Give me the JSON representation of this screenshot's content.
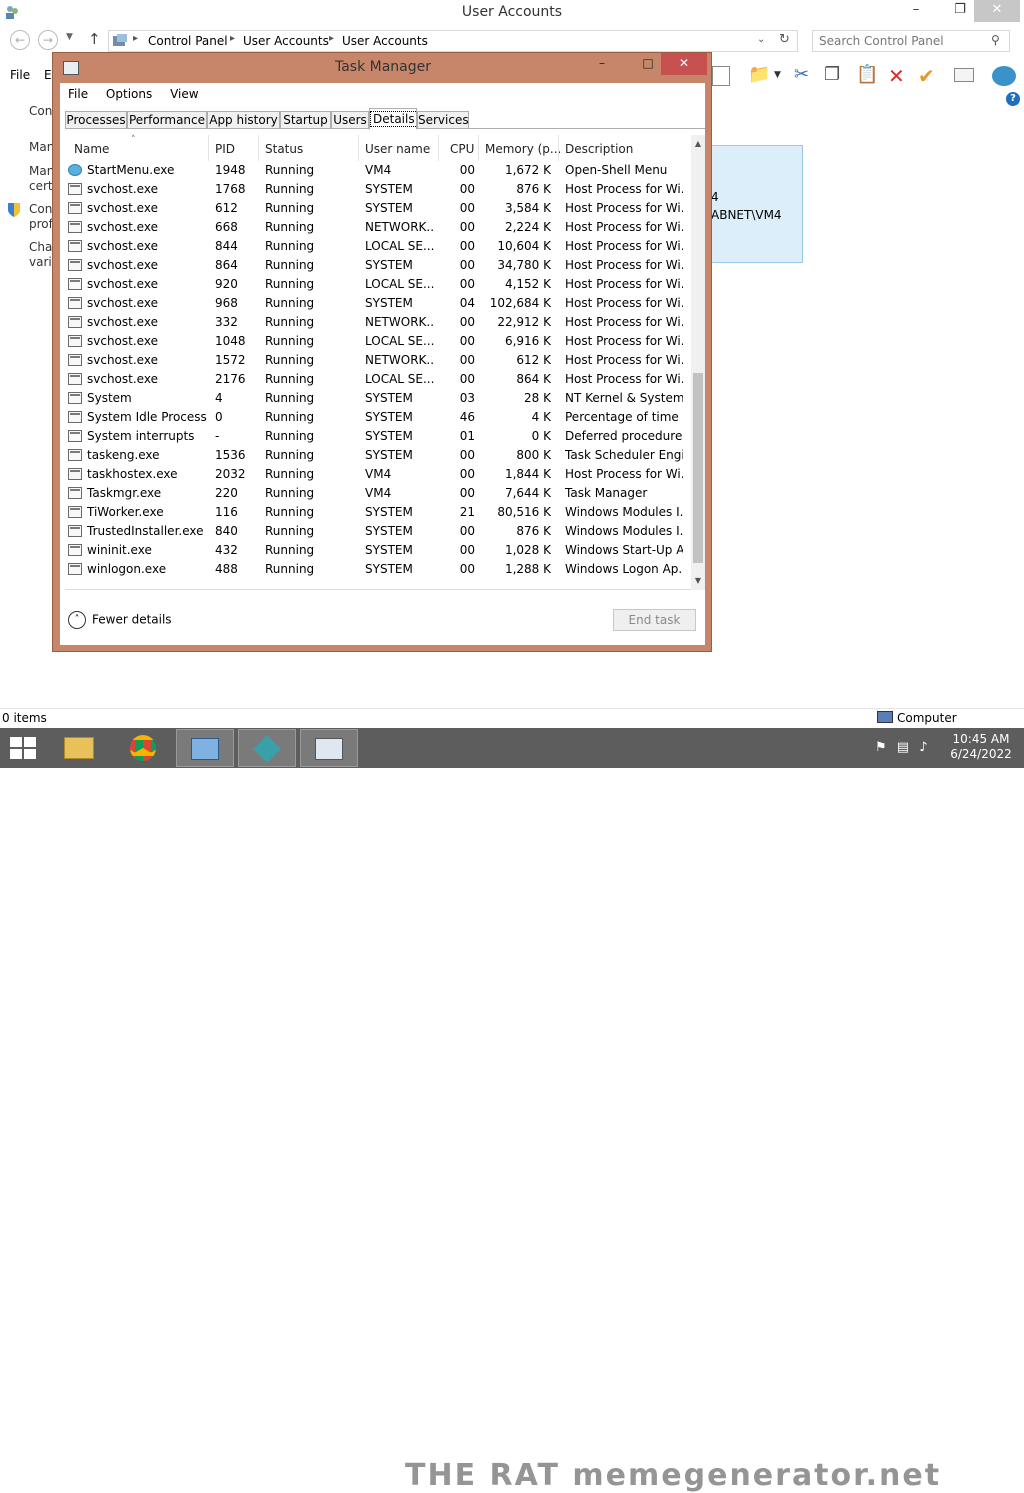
{
  "explorer": {
    "title": "User Accounts",
    "minimize": "–",
    "maximize": "❐",
    "close": "✕",
    "breadcrumbs": [
      "Control Panel",
      "User Accounts",
      "User Accounts"
    ],
    "search_placeholder": "Search Control Panel",
    "menu_items": [
      "File",
      "E"
    ],
    "sidebar_fragments": [
      "Con",
      "Man",
      "Man",
      "certi",
      "Con",
      "prof",
      "Chan",
      "varia"
    ],
    "panel_text_1": "4",
    "panel_text_2": "ABNET\\VM4",
    "status_items": "0 items",
    "status_location": "Computer"
  },
  "task_manager": {
    "title": "Task Manager",
    "minimize": "–",
    "maximize": "□",
    "close": "✕",
    "menu": [
      "File",
      "Options",
      "View"
    ],
    "tabs": [
      "Processes",
      "Performance",
      "App history",
      "Startup",
      "Users",
      "Details",
      "Services"
    ],
    "active_tab": "Details",
    "columns": [
      "Name",
      "PID",
      "Status",
      "User name",
      "CPU",
      "Memory (p...",
      "Description"
    ],
    "rows": [
      {
        "icon": "globe",
        "name": "StartMenu.exe",
        "pid": "1948",
        "status": "Running",
        "user": "VM4",
        "cpu": "00",
        "mem": "1,672 K",
        "desc": "Open-Shell Menu"
      },
      {
        "icon": "window",
        "name": "svchost.exe",
        "pid": "1768",
        "status": "Running",
        "user": "SYSTEM",
        "cpu": "00",
        "mem": "876 K",
        "desc": "Host Process for Wi..."
      },
      {
        "icon": "window",
        "name": "svchost.exe",
        "pid": "612",
        "status": "Running",
        "user": "SYSTEM",
        "cpu": "00",
        "mem": "3,584 K",
        "desc": "Host Process for Wi..."
      },
      {
        "icon": "window",
        "name": "svchost.exe",
        "pid": "668",
        "status": "Running",
        "user": "NETWORK...",
        "cpu": "00",
        "mem": "2,224 K",
        "desc": "Host Process for Wi..."
      },
      {
        "icon": "window",
        "name": "svchost.exe",
        "pid": "844",
        "status": "Running",
        "user": "LOCAL SE...",
        "cpu": "00",
        "mem": "10,604 K",
        "desc": "Host Process for Wi..."
      },
      {
        "icon": "window",
        "name": "svchost.exe",
        "pid": "864",
        "status": "Running",
        "user": "SYSTEM",
        "cpu": "00",
        "mem": "34,780 K",
        "desc": "Host Process for Wi..."
      },
      {
        "icon": "window",
        "name": "svchost.exe",
        "pid": "920",
        "status": "Running",
        "user": "LOCAL SE...",
        "cpu": "00",
        "mem": "4,152 K",
        "desc": "Host Process for Wi..."
      },
      {
        "icon": "window",
        "name": "svchost.exe",
        "pid": "968",
        "status": "Running",
        "user": "SYSTEM",
        "cpu": "04",
        "mem": "102,684 K",
        "desc": "Host Process for Wi..."
      },
      {
        "icon": "window",
        "name": "svchost.exe",
        "pid": "332",
        "status": "Running",
        "user": "NETWORK...",
        "cpu": "00",
        "mem": "22,912 K",
        "desc": "Host Process for Wi..."
      },
      {
        "icon": "window",
        "name": "svchost.exe",
        "pid": "1048",
        "status": "Running",
        "user": "LOCAL SE...",
        "cpu": "00",
        "mem": "6,916 K",
        "desc": "Host Process for Wi..."
      },
      {
        "icon": "window",
        "name": "svchost.exe",
        "pid": "1572",
        "status": "Running",
        "user": "NETWORK...",
        "cpu": "00",
        "mem": "612 K",
        "desc": "Host Process for Wi..."
      },
      {
        "icon": "window",
        "name": "svchost.exe",
        "pid": "2176",
        "status": "Running",
        "user": "LOCAL SE...",
        "cpu": "00",
        "mem": "864 K",
        "desc": "Host Process for Wi..."
      },
      {
        "icon": "window",
        "name": "System",
        "pid": "4",
        "status": "Running",
        "user": "SYSTEM",
        "cpu": "03",
        "mem": "28 K",
        "desc": "NT Kernel & System"
      },
      {
        "icon": "window",
        "name": "System Idle Process",
        "pid": "0",
        "status": "Running",
        "user": "SYSTEM",
        "cpu": "46",
        "mem": "4 K",
        "desc": "Percentage of time t..."
      },
      {
        "icon": "window",
        "name": "System interrupts",
        "pid": "-",
        "status": "Running",
        "user": "SYSTEM",
        "cpu": "01",
        "mem": "0 K",
        "desc": "Deferred procedure ..."
      },
      {
        "icon": "window",
        "name": "taskeng.exe",
        "pid": "1536",
        "status": "Running",
        "user": "SYSTEM",
        "cpu": "00",
        "mem": "800 K",
        "desc": "Task Scheduler Engi..."
      },
      {
        "icon": "window",
        "name": "taskhostex.exe",
        "pid": "2032",
        "status": "Running",
        "user": "VM4",
        "cpu": "00",
        "mem": "1,844 K",
        "desc": "Host Process for Wi..."
      },
      {
        "icon": "window",
        "name": "Taskmgr.exe",
        "pid": "220",
        "status": "Running",
        "user": "VM4",
        "cpu": "00",
        "mem": "7,644 K",
        "desc": "Task Manager"
      },
      {
        "icon": "window",
        "name": "TiWorker.exe",
        "pid": "116",
        "status": "Running",
        "user": "SYSTEM",
        "cpu": "21",
        "mem": "80,516 K",
        "desc": "Windows Modules I..."
      },
      {
        "icon": "window",
        "name": "TrustedInstaller.exe",
        "pid": "840",
        "status": "Running",
        "user": "SYSTEM",
        "cpu": "00",
        "mem": "876 K",
        "desc": "Windows Modules I..."
      },
      {
        "icon": "window",
        "name": "wininit.exe",
        "pid": "432",
        "status": "Running",
        "user": "SYSTEM",
        "cpu": "00",
        "mem": "1,028 K",
        "desc": "Windows Start-Up A..."
      },
      {
        "icon": "window",
        "name": "winlogon.exe",
        "pid": "488",
        "status": "Running",
        "user": "SYSTEM",
        "cpu": "00",
        "mem": "1,288 K",
        "desc": "Windows Logon Ap..."
      }
    ],
    "fewer_details": "Fewer details",
    "end_task": "End task"
  },
  "taskbar": {
    "time": "10:45 AM",
    "date": "6/24/2022",
    "watermark": "THE RAT  memegenerator.net"
  },
  "colors": {
    "task_manager_frame": "#c7866a",
    "taskbar": "#5d5d5d",
    "close_red": "#c75050"
  }
}
